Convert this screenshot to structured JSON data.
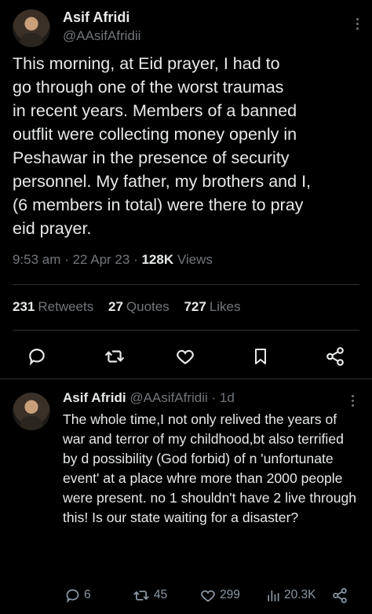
{
  "tweet": {
    "author_name": "Asif Afridi",
    "author_handle": "@AAsifAfridii",
    "text": "This morning, at Eid prayer, I had to\ngo through one of the worst traumas\nin recent years. Members of a banned\noutflit were collecting money openly in\nPeshawar in the presence of security\npersonnel. My father, my brothers and I,\n(6 members in total) were there to pray\neid prayer.",
    "time": "9:53 am",
    "date": "22 Apr 23",
    "views_count": "128K",
    "views_label": "Views",
    "retweets_count": "231",
    "retweets_label": "Retweets",
    "quotes_count": "27",
    "quotes_label": "Quotes",
    "likes_count": "727",
    "likes_label": "Likes",
    "actions": [
      "reply-icon",
      "retweet-icon",
      "like-icon",
      "bookmark-icon",
      "share-icon"
    ]
  },
  "reply": {
    "author_name": "Asif Afridi",
    "author_handle": "@AAsifAfridii",
    "age": "1d",
    "text": "The whole time,I not only relived the years of war and terror of my childhood,bt also terrified by d possibility (God forbid) of n 'unfortunate event' at a place whre more than 2000 people were present. no 1 shouldn't have 2 live through this! Is our state waiting for a disaster?",
    "replies": "6",
    "retweets": "45",
    "likes": "299",
    "views": "20.3K"
  },
  "colors": {
    "background": "#000000",
    "text": "#e7e9ea",
    "secondary": "#71767b",
    "divider": "#2f3336"
  }
}
